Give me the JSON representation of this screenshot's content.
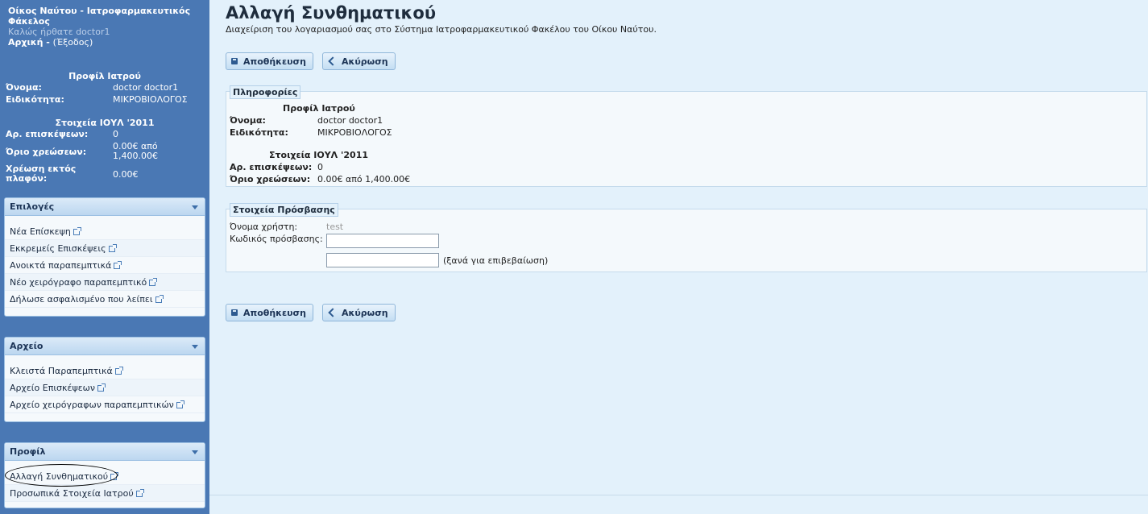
{
  "sidebar": {
    "app_title": "Οίκος Ναύτου - Ιατροφαρμακευτικός Φάκελος",
    "welcome": "Καλώς ήρθατε doctor1",
    "home_link": "Αρχική",
    "separator": " - ",
    "logout_link": "Έξοδος",
    "profile_heading": "Προφίλ Ιατρού",
    "name_label": "Όνομα:",
    "name_value": "doctor doctor1",
    "specialty_label": "Ειδικότητα:",
    "specialty_value": "ΜΙΚΡΟΒΙΟΛΟΓΟΣ",
    "stats_heading": "Στοιχεία ΙΟΥΛ '2011",
    "visits_label": "Αρ. επισκέψεων:",
    "visits_value": "0",
    "limit_label": "Όριο χρεώσεων:",
    "limit_value": "0.00€ από 1,400.00€",
    "overlimit_label": "Χρέωση εκτός πλαφόν:",
    "overlimit_value": "0.00€"
  },
  "panels": {
    "options": {
      "title": "Επιλογές",
      "items": [
        "Νέα Επίσκεψη",
        "Εκκρεμείς Επισκέψεις",
        "Ανοικτά παραπεμπτικά",
        "Νέο χειρόγραφο παραπεμπτικό",
        "Δήλωσε ασφαλισμένο που λείπει"
      ]
    },
    "archive": {
      "title": "Αρχείο",
      "items": [
        "Κλειστά Παραπεμπτικά",
        "Αρχείο Επισκέψεων",
        "Αρχείο χειρόγραφων παραπεμπτικών"
      ]
    },
    "profile": {
      "title": "Προφίλ",
      "items": [
        "Αλλαγή Συνθηματικού",
        "Προσωπικά Στοιχεία Ιατρού"
      ]
    }
  },
  "main": {
    "title": "Αλλαγή Συνθηματικού",
    "subtitle": "Διαχείριση του λογαριασμού σας στο Σύστημα Ιατροφαρμακευτικού Φακέλου του Οίκου Ναύτου.",
    "save_label": "Αποθήκευση",
    "cancel_label": "Ακύρωση",
    "info": {
      "legend": "Πληροφορίες",
      "profile_heading": "Προφίλ Ιατρού",
      "name_label": "Όνομα:",
      "name_value": "doctor doctor1",
      "specialty_label": "Ειδικότητα:",
      "specialty_value": "ΜΙΚΡΟΒΙΟΛΟΓΟΣ",
      "stats_heading": "Στοιχεία ΙΟΥΛ '2011",
      "visits_label": "Αρ. επισκέψεων:",
      "visits_value": "0",
      "limit_label": "Όριο χρεώσεων:",
      "limit_value": "0.00€ από 1,400.00€"
    },
    "access": {
      "legend": "Στοιχεία Πρόσβασης",
      "username_label": "Όνομα χρήστη:",
      "username_value": "test",
      "password_label": "Κωδικός πρόσβασης:",
      "password_value": "",
      "confirm_value": "",
      "confirm_hint": "(ξανά για επιβεβαίωση)"
    }
  },
  "colors": {
    "sidebar_bg": "#4a78b4",
    "main_bg": "#e3f1fb",
    "panel_header": "#bcd7f0"
  }
}
